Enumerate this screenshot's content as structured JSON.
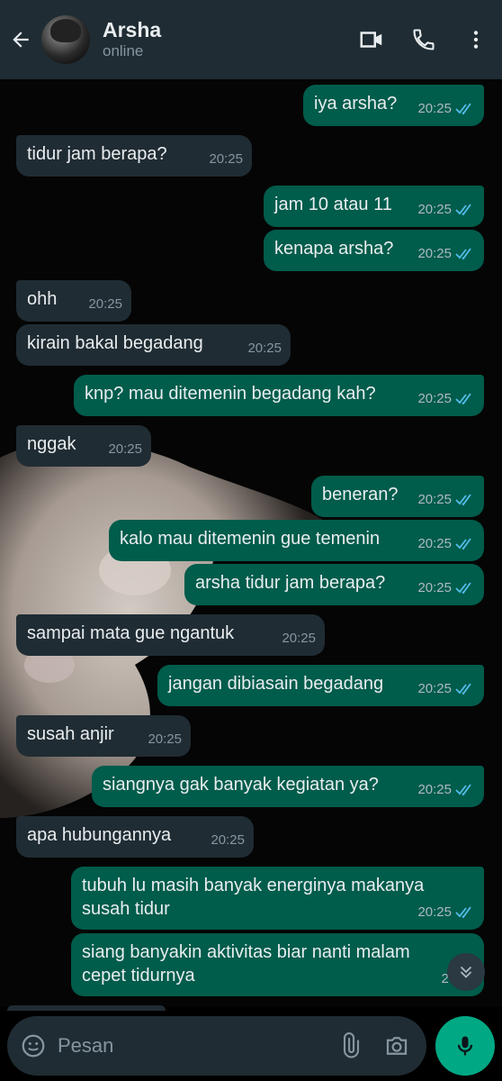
{
  "header": {
    "name": "Arsha",
    "status": "online"
  },
  "messages": [
    {
      "dir": "out",
      "text": "iya arsha?",
      "time": "20:25"
    },
    {
      "dir": "in",
      "text": "tidur jam berapa?",
      "time": "20:25"
    },
    {
      "dir": "out",
      "text": "jam 10 atau 11",
      "time": "20:25"
    },
    {
      "dir": "out",
      "text": "kenapa arsha?",
      "time": "20:25"
    },
    {
      "dir": "in",
      "text": "ohh",
      "time": "20:25"
    },
    {
      "dir": "in",
      "text": "kirain bakal begadang",
      "time": "20:25"
    },
    {
      "dir": "out",
      "text": "knp? mau ditemenin begadang kah?",
      "time": "20:25"
    },
    {
      "dir": "in",
      "text": "nggak",
      "time": "20:25"
    },
    {
      "dir": "out",
      "text": "beneran?",
      "time": "20:25"
    },
    {
      "dir": "out",
      "text": "kalo mau ditemenin gue temenin",
      "time": "20:25"
    },
    {
      "dir": "out",
      "text": "arsha tidur jam berapa?",
      "time": "20:25"
    },
    {
      "dir": "in",
      "text": "sampai mata gue ngantuk",
      "time": "20:25"
    },
    {
      "dir": "out",
      "text": "jangan dibiasain begadang",
      "time": "20:25"
    },
    {
      "dir": "in",
      "text": "susah anjir",
      "time": "20:25"
    },
    {
      "dir": "out",
      "text": "siangnya gak banyak kegiatan ya?",
      "time": "20:25"
    },
    {
      "dir": "in",
      "text": "apa hubungannya",
      "time": "20:25"
    },
    {
      "dir": "out",
      "text": "tubuh lu masih banyak energinya makanya\nsusah tidur",
      "time": "20:25"
    },
    {
      "dir": "out",
      "text": "siang banyakin aktivitas biar nanti malam\ncepet tidurnya",
      "time": "20:25"
    }
  ],
  "composer": {
    "placeholder": "Pesan"
  },
  "colors": {
    "header_bg": "#1f2c33",
    "incoming_bubble": "#202c33",
    "outgoing_bubble": "#005c4b",
    "read_ticks": "#53bdeb",
    "mic_button": "#00a884"
  },
  "icons": [
    "back-arrow-icon",
    "video-call-icon",
    "phone-icon",
    "more-vert-icon",
    "emoji-icon",
    "attach-icon",
    "camera-icon",
    "mic-icon",
    "double-chevron-down-icon",
    "double-check-icon"
  ]
}
